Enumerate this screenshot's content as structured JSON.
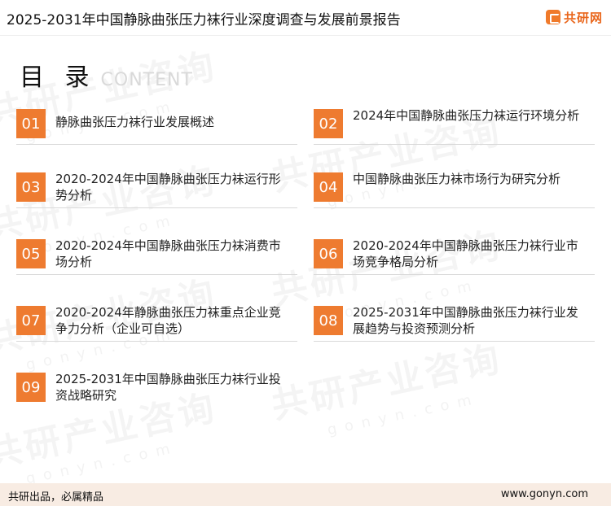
{
  "header": {
    "title": "2025-2031年中国静脉曲张压力袜行业深度调查与发展前景报告",
    "logo_text": "共研网"
  },
  "toc": {
    "title_cn": "目 录",
    "title_en": "CONTENT",
    "items": [
      {
        "num": "01",
        "label": "静脉曲张压力袜行业发展概述"
      },
      {
        "num": "02",
        "label": "2024年中国静脉曲张压力袜运行环境分析"
      },
      {
        "num": "03",
        "label": "2020-2024年中国静脉曲张压力袜运行形势分析"
      },
      {
        "num": "04",
        "label": "中国静脉曲张压力袜市场行为研究分析"
      },
      {
        "num": "05",
        "label": "2020-2024年中国静脉曲张压力袜消费市场分析"
      },
      {
        "num": "06",
        "label": "2020-2024年中国静脉曲张压力袜行业市场竞争格局分析"
      },
      {
        "num": "07",
        "label": "2020-2024年静脉曲张压力袜重点企业竞争力分析（企业可自选）"
      },
      {
        "num": "08",
        "label": "2025-2031年中国静脉曲张压力袜行业发展趋势与投资预测分析"
      },
      {
        "num": "09",
        "label": "2025-2031年中国静脉曲张压力袜行业投资战略研究"
      }
    ]
  },
  "watermark": {
    "brand": "共研产业咨询",
    "site": "gonyn.com"
  },
  "footer": {
    "slogan": "共研出品，必属精品",
    "url": "www.gonyn.com"
  },
  "colors": {
    "accent": "#ee7b30",
    "footer_bg": "#f8ece3"
  }
}
